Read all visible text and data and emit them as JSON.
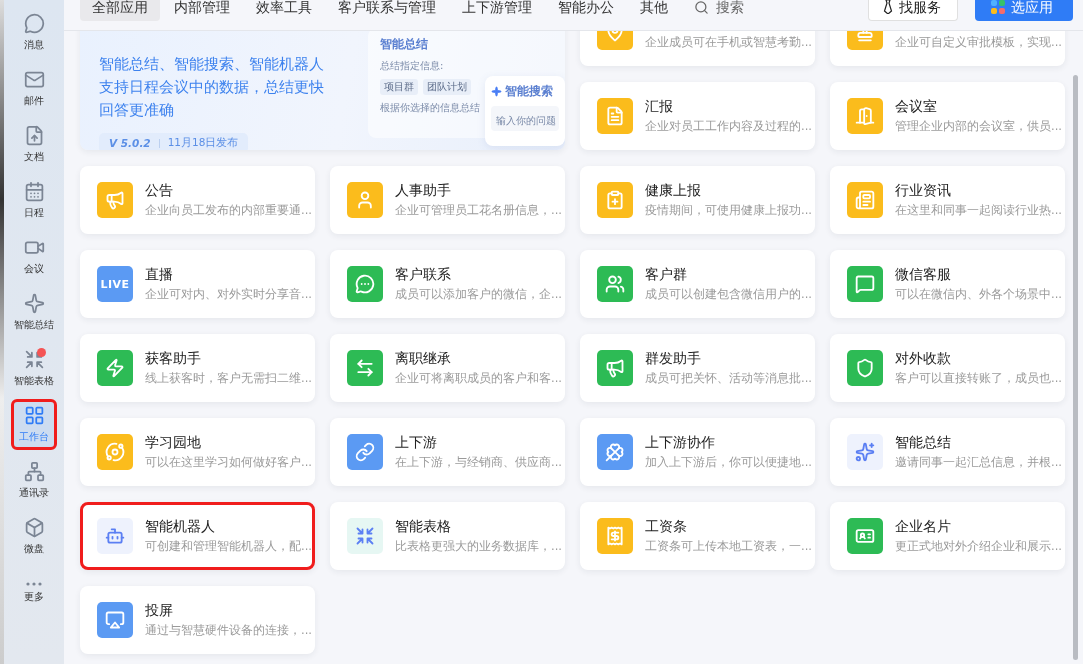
{
  "sidebar": {
    "items": [
      {
        "label": "消息",
        "selected": false,
        "badge": false,
        "highlighted": false
      },
      {
        "label": "邮件",
        "selected": false,
        "badge": false,
        "highlighted": false
      },
      {
        "label": "文档",
        "selected": false,
        "badge": false,
        "highlighted": false
      },
      {
        "label": "日程",
        "selected": false,
        "badge": false,
        "highlighted": false
      },
      {
        "label": "会议",
        "selected": false,
        "badge": false,
        "highlighted": false
      },
      {
        "label": "智能总结",
        "selected": false,
        "badge": false,
        "highlighted": false
      },
      {
        "label": "智能表格",
        "selected": false,
        "badge": true,
        "highlighted": false
      },
      {
        "label": "工作台",
        "selected": true,
        "badge": false,
        "highlighted": true
      },
      {
        "label": "通讯录",
        "selected": false,
        "badge": false,
        "highlighted": false
      },
      {
        "label": "微盘",
        "selected": false,
        "badge": false,
        "highlighted": false
      },
      {
        "label": "更多",
        "selected": false,
        "badge": false,
        "highlighted": false
      }
    ]
  },
  "tabs": [
    {
      "label": "全部应用",
      "selected": true
    },
    {
      "label": "内部管理",
      "selected": false
    },
    {
      "label": "效率工具",
      "selected": false
    },
    {
      "label": "客户联系与管理",
      "selected": false
    },
    {
      "label": "上下游管理",
      "selected": false
    },
    {
      "label": "智能办公",
      "selected": false
    },
    {
      "label": "其他",
      "selected": false
    }
  ],
  "search": {
    "placeholder": "搜索"
  },
  "buttons": {
    "service": "找服务",
    "choose_apps": "选应用"
  },
  "banner": {
    "lines": [
      "智能总结、智能搜索、智能机器人",
      "支持日程会议中的数据，总结更快",
      "回答更准确"
    ],
    "version": "V 5.0.2",
    "date": "11月18日发布",
    "mock": {
      "summary_title": "智能总结",
      "summary_prompt": "总结指定信息:",
      "chips": [
        "项目群",
        "团队计划"
      ],
      "summary_hint": "根据你选择的信息总结",
      "search_title": "智能搜索",
      "search_placeholder": "输入你的问题"
    }
  },
  "apps": [
    {
      "description": "企业成员可在手机或智慧考勤...",
      "color": "#fbbc1c",
      "highlighted": false
    },
    {
      "description": "企业可自定义审批模板，实现...",
      "color": "#fbbc1c",
      "highlighted": false
    },
    {
      "title": "汇报",
      "description": "企业对员工工作内容及过程的...",
      "color": "#fbbc1c",
      "highlighted": false
    },
    {
      "title": "会议室",
      "description": "管理企业内部的会议室，供员...",
      "color": "#fbbc1c",
      "highlighted": false
    },
    {
      "title": "公告",
      "description": "企业向员工发布的内部重要通...",
      "color": "#fbbc1c",
      "highlighted": false
    },
    {
      "title": "人事助手",
      "description": "企业可管理员工花名册信息，...",
      "color": "#fbbc1c",
      "highlighted": false
    },
    {
      "title": "健康上报",
      "description": "疫情期间，可使用健康上报功...",
      "color": "#fbbc1c",
      "highlighted": false
    },
    {
      "title": "行业资讯",
      "description": "在这里和同事一起阅读行业热...",
      "color": "#fbbc1c",
      "highlighted": false
    },
    {
      "title": "直播",
      "description": "企业可对内、对外实时分享音...",
      "color": "#5b9af3",
      "icon_text": "LIVE",
      "highlighted": false
    },
    {
      "title": "客户联系",
      "description": "成员可以添加客户的微信，企...",
      "color": "#2dbb55",
      "highlighted": false
    },
    {
      "title": "客户群",
      "description": "成员可以创建包含微信用户的...",
      "color": "#2dbb55",
      "highlighted": false
    },
    {
      "title": "微信客服",
      "description": "可以在微信内、外各个场景中...",
      "color": "#2dbb55",
      "highlighted": false
    },
    {
      "title": "获客助手",
      "description": "线上获客时，客户无需扫二维...",
      "color": "#2dbb55",
      "highlighted": false
    },
    {
      "title": "离职继承",
      "description": "企业可将离职成员的客户和客...",
      "color": "#2dbb55",
      "highlighted": false
    },
    {
      "title": "群发助手",
      "description": "成员可把关怀、活动等消息批...",
      "color": "#2dbb55",
      "highlighted": false
    },
    {
      "title": "对外收款",
      "description": "客户可以直接转账了，成员也...",
      "color": "#2dbb55",
      "highlighted": false
    },
    {
      "title": "学习园地",
      "description": "可以在这里学习如何做好客户...",
      "color": "#fbbc1c",
      "highlighted": false
    },
    {
      "title": "上下游",
      "description": "在上下游，与经销商、供应商...",
      "color": "#5b9af3",
      "highlighted": false
    },
    {
      "title": "上下游协作",
      "description": "加入上下游后，你可以便捷地...",
      "color": "#5b9af3",
      "highlighted": false
    },
    {
      "title": "智能总结",
      "description": "邀请同事一起汇总信息，并根...",
      "color": "#eef2fd",
      "highlighted": false
    },
    {
      "title": "智能机器人",
      "description": "可创建和管理智能机器人，配...",
      "color": "#eef2fd",
      "highlighted": true
    },
    {
      "title": "智能表格",
      "description": "比表格更强大的业务数据库，...",
      "color": "#e6f7f3",
      "highlighted": false
    },
    {
      "title": "工资条",
      "description": "工资条可上传本地工资表，一...",
      "color": "#fbbc1c",
      "highlighted": false
    },
    {
      "title": "企业名片",
      "description": "更正式地对外介绍企业和展示...",
      "color": "#2dbb55",
      "highlighted": false
    },
    {
      "title": "投屏",
      "description": "通过与智慧硬件设备的连接，...",
      "color": "#5b9af3",
      "highlighted": false
    }
  ]
}
